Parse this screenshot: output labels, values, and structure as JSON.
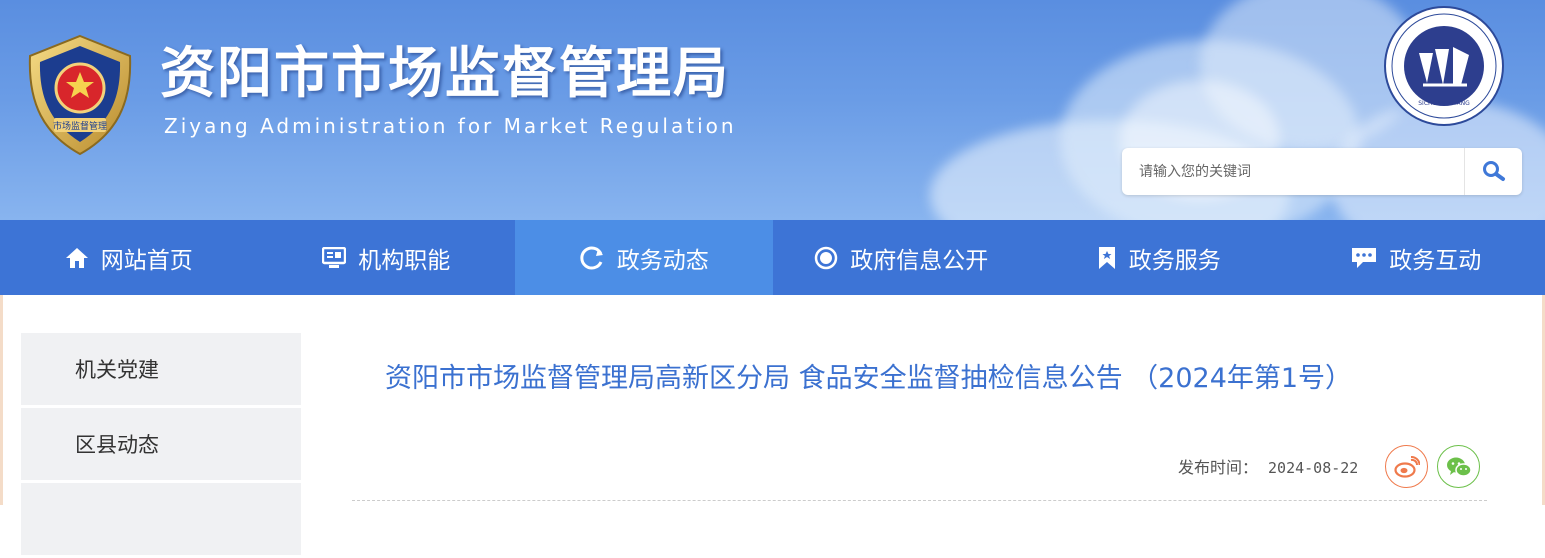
{
  "header": {
    "title": "资阳市市场监督管理局",
    "subtitle": "Ziyang  Administration for  Market Regulation",
    "emblem_text": "市场监督管理",
    "badge_text": "SICHUAN ZIYANG",
    "search_placeholder": "请输入您的关键词"
  },
  "nav": {
    "items": [
      {
        "label": "网站首页",
        "icon": "home-icon"
      },
      {
        "label": "机构职能",
        "icon": "monitor-icon"
      },
      {
        "label": "政务动态",
        "icon": "refresh-icon",
        "active": true
      },
      {
        "label": "政府信息公开",
        "icon": "circle-icon"
      },
      {
        "label": "政务服务",
        "icon": "bookmark-icon"
      },
      {
        "label": "政务互动",
        "icon": "chat-icon"
      }
    ]
  },
  "sidebar": {
    "items": [
      {
        "label": "机关党建"
      },
      {
        "label": "区县动态"
      },
      {
        "label": ""
      }
    ]
  },
  "article": {
    "title": "资阳市市场监督管理局高新区分局 食品安全监督抽检信息公告 （2024年第1号）",
    "publish_label": "发布时间：",
    "publish_date": "2024-08-22"
  },
  "colors": {
    "nav_bg": "#3d74d6",
    "nav_active": "#4c8ee6",
    "title_color": "#3b71d0",
    "weibo": "#ef7a4c",
    "wechat": "#6cc04a"
  }
}
